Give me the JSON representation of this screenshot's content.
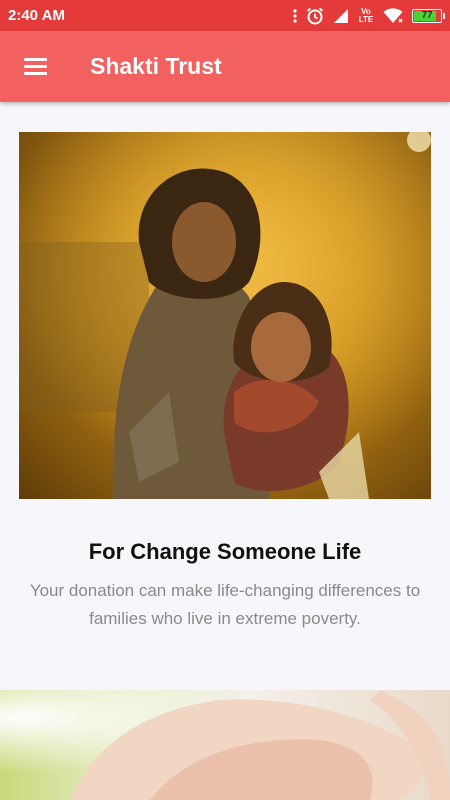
{
  "status_bar": {
    "time": "2:40 AM",
    "volte": "Vo LTE",
    "battery_level": "77",
    "battery_fraction": 0.77,
    "icons": [
      "more-icon",
      "alarm-icon",
      "signal-icon",
      "volte-icon",
      "wifi-icon",
      "battery-icon"
    ]
  },
  "app_bar": {
    "title": "Shakti Trust",
    "menu_icon": "hamburger-icon",
    "color": "#f26060"
  },
  "card": {
    "title": "For Change Someone Life",
    "description": "Your donation can make life-changing differences to families who live in extreme poverty."
  },
  "colors": {
    "status_bar": "#e43a3a",
    "app_bar": "#f26060",
    "background": "#f7f6fb"
  }
}
